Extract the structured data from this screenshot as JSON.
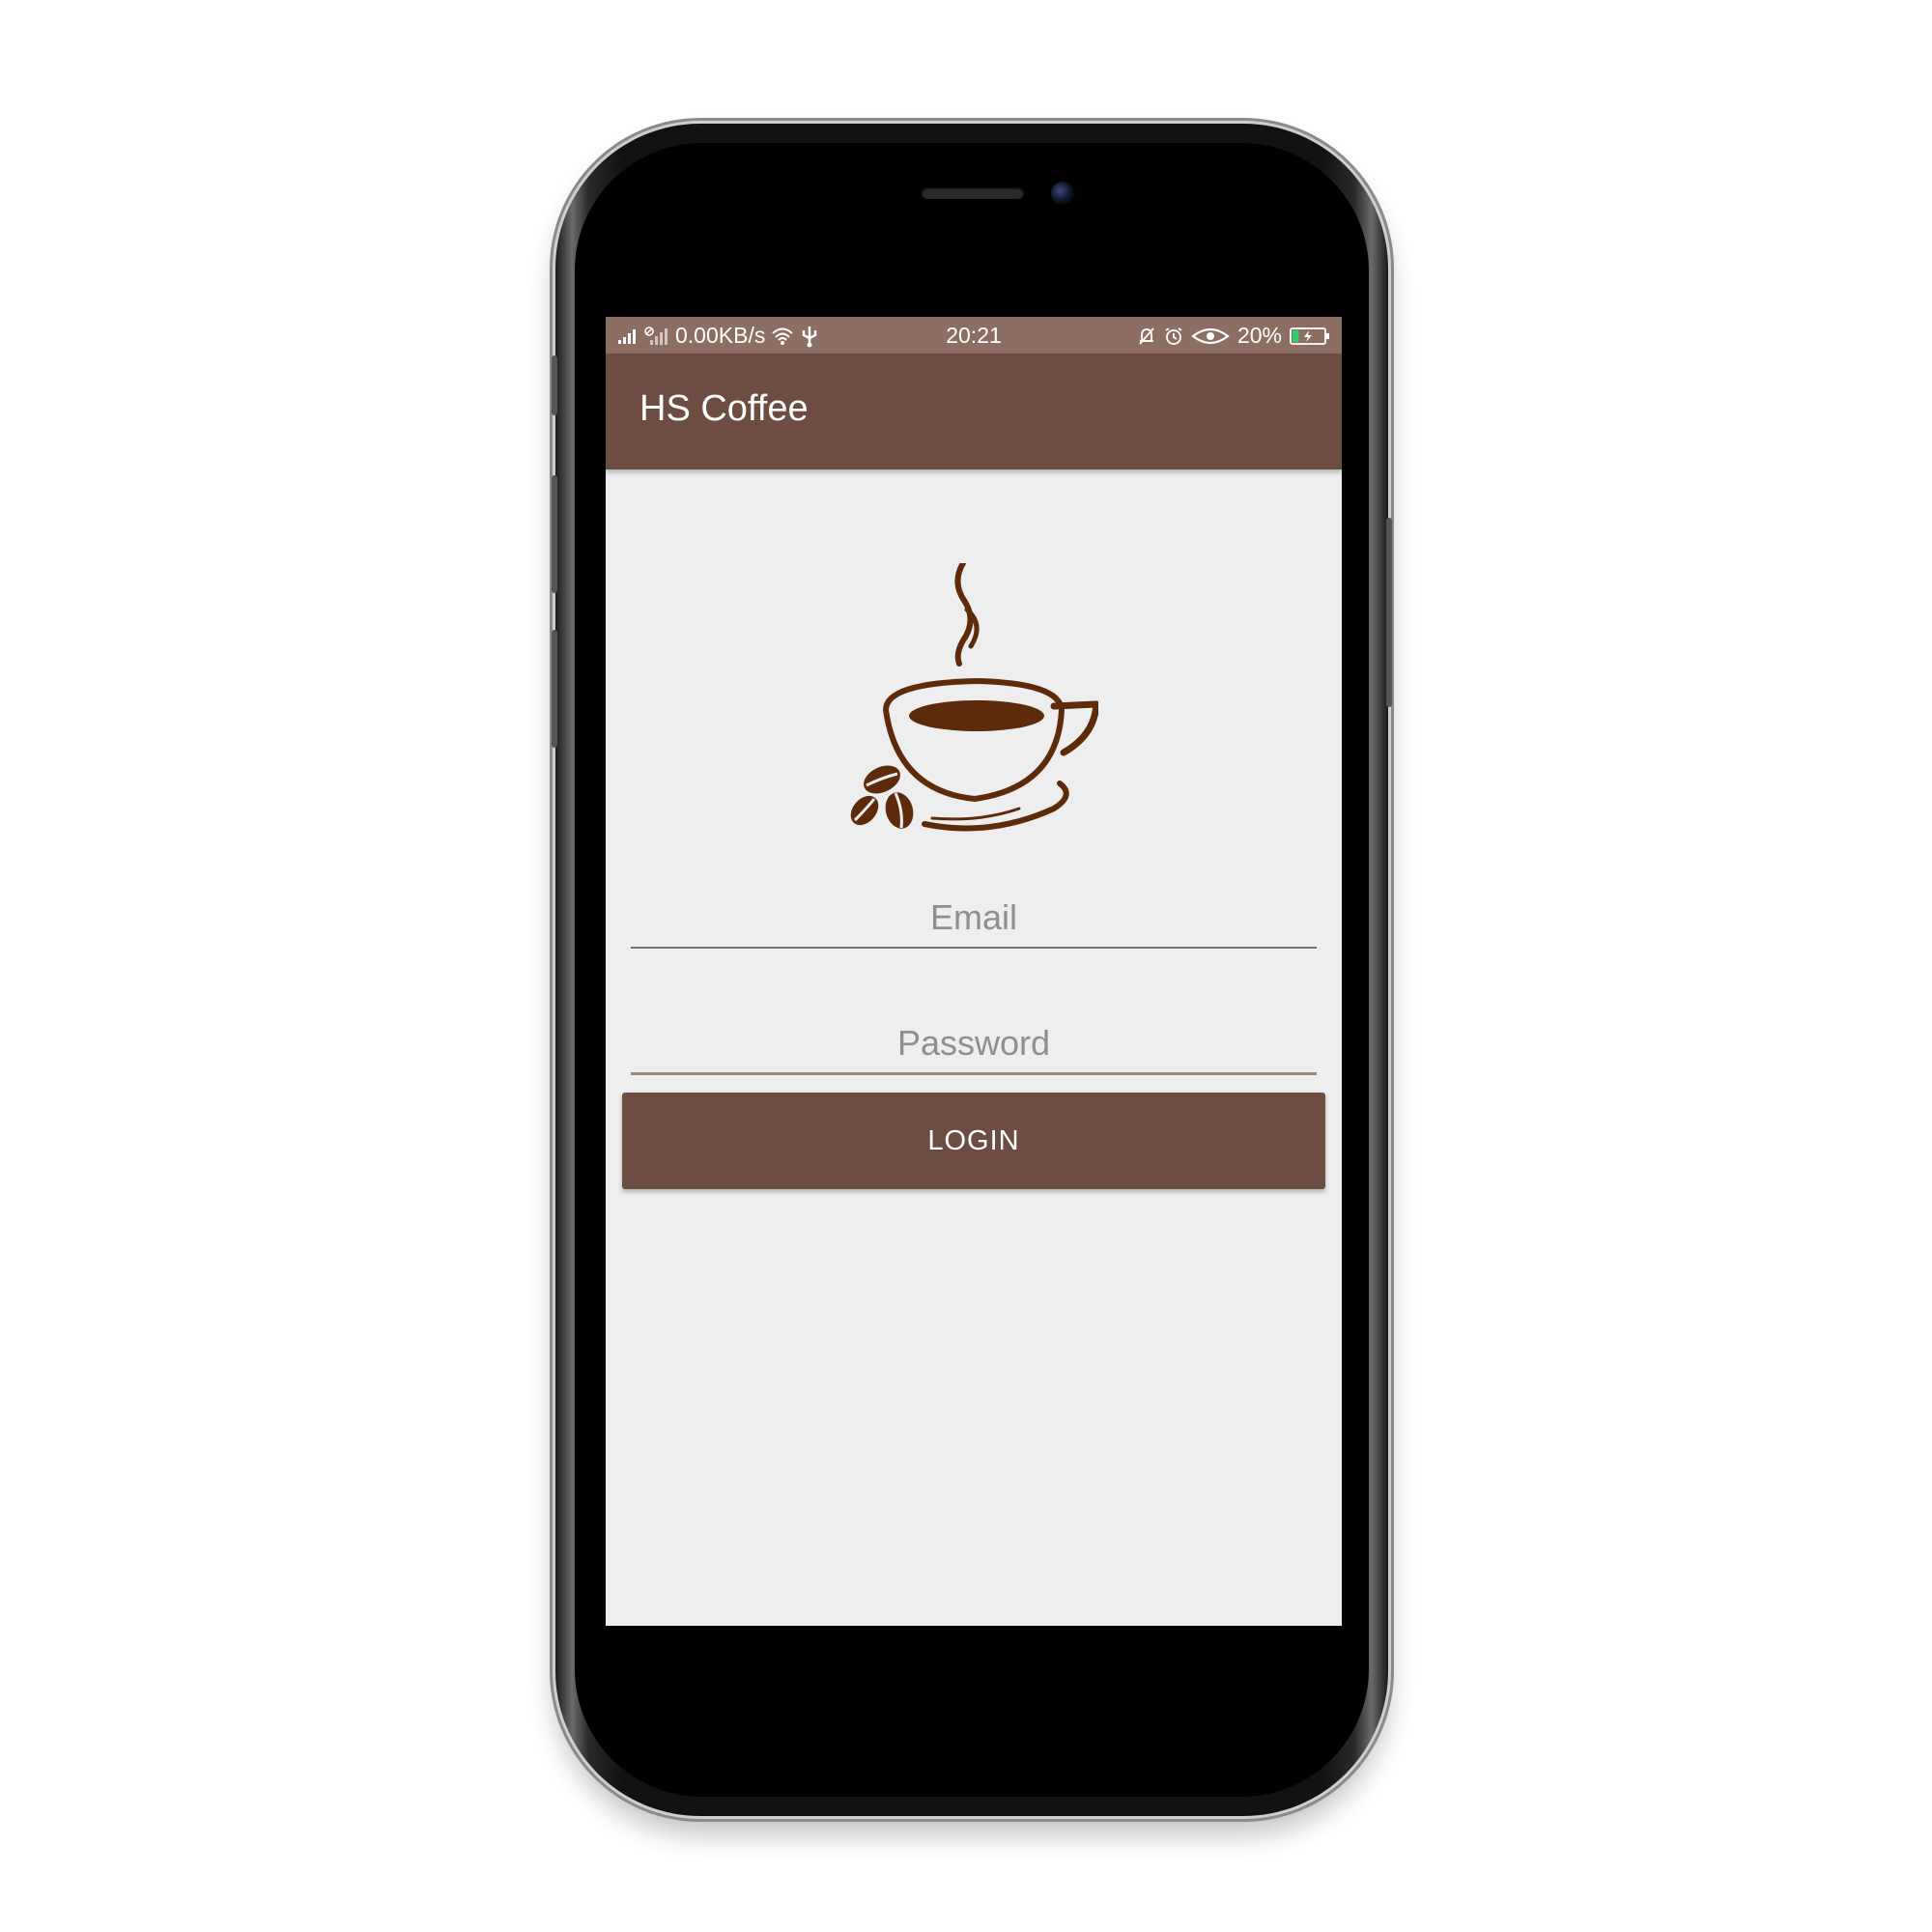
{
  "status_bar": {
    "network_speed": "0.00KB/s",
    "time": "20:21",
    "battery": "20%",
    "battery_level": 0.2,
    "icons": [
      "signal-icon",
      "signal-icon",
      "wifi-icon",
      "usb-icon",
      "silent-bell-icon",
      "alarm-icon",
      "eye-icon",
      "battery-icon"
    ]
  },
  "app_bar": {
    "title": "HS Coffee"
  },
  "form": {
    "email_placeholder": "Email",
    "password_placeholder": "Password",
    "login_label": "LOGIN"
  },
  "colors": {
    "primary": "#6d4c41",
    "primary_light": "#8d6e63",
    "logo": "#5d2a0a",
    "background": "#eeeeee"
  }
}
